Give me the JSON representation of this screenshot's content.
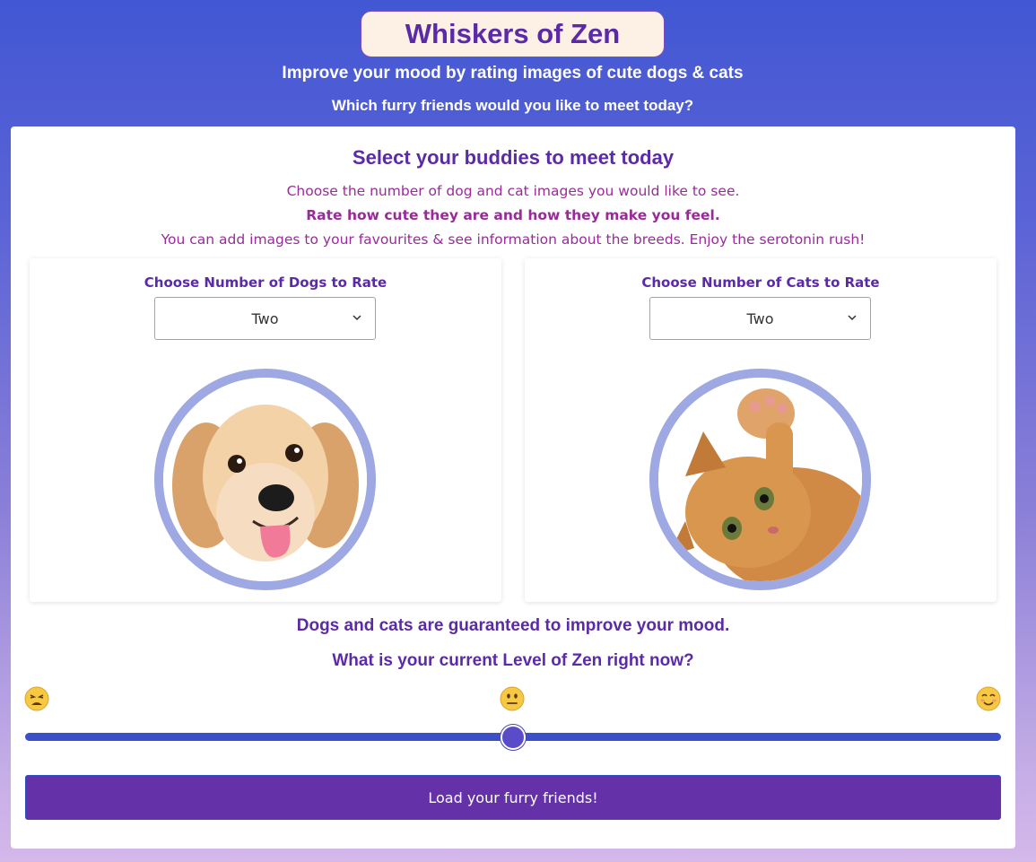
{
  "header": {
    "title": "Whiskers of Zen",
    "subtitle": "Improve your mood by rating images of cute dogs & cats",
    "question": "Which furry friends would you like to meet today?"
  },
  "panel": {
    "heading": "Select your buddies to meet today",
    "intro_line1": "Choose the number of dog and cat images you would like to see.",
    "intro_line2": "Rate how cute they are and how they make you feel.",
    "intro_line3": "You can add images to your favourites & see information about the breeds. Enjoy the serotonin rush!"
  },
  "dogs": {
    "label": "Choose Number of Dogs to Rate",
    "selected": "Two"
  },
  "cats": {
    "label": "Choose Number of Cats to Rate",
    "selected": "Two"
  },
  "mood": {
    "line1": "Dogs and cats are guaranteed to improve your mood.",
    "line2": "What is your current Level of Zen right now?",
    "emoji_low": "😩",
    "emoji_mid": "😐",
    "emoji_high": "😊",
    "slider_value_percent": 50
  },
  "actions": {
    "load_label": "Load your furry friends!"
  },
  "colors": {
    "accent": "#5b2aa8",
    "button": "#6431a8",
    "slider": "#3b4fc8",
    "ring": "#9ea8e2"
  }
}
